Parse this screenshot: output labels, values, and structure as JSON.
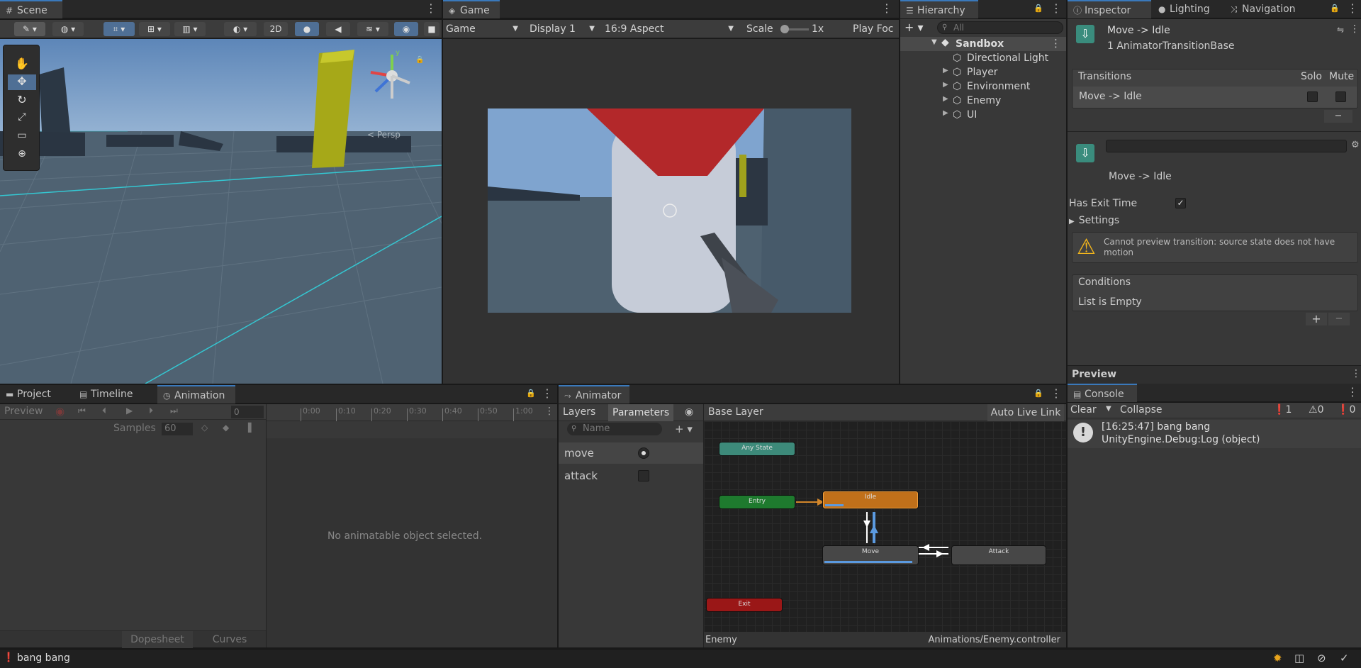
{
  "scene": {
    "tab": "Scene",
    "mode_2d": "2D",
    "persp_label": "< Persp",
    "axis_y": "y"
  },
  "game": {
    "tab": "Game",
    "display_mode": "Game",
    "display": "Display 1",
    "aspect": "16:9 Aspect",
    "scale_label": "Scale",
    "scale_value": "1x",
    "play_focused": "Play Foc"
  },
  "hierarchy": {
    "tab": "Hierarchy",
    "search_placeholder": "All",
    "scene_name": "Sandbox",
    "items": [
      {
        "label": "Directional Light",
        "expandable": false
      },
      {
        "label": "Player",
        "expandable": true
      },
      {
        "label": "Environment",
        "expandable": true
      },
      {
        "label": "Enemy",
        "expandable": true
      },
      {
        "label": "UI",
        "expandable": true
      }
    ]
  },
  "inspector": {
    "tabs": [
      "Inspector",
      "Lighting",
      "Navigation"
    ],
    "title": "Move -> Idle",
    "subtitle": "1 AnimatorTransitionBase",
    "transitions_header": "Transitions",
    "solo": "Solo",
    "mute": "Mute",
    "transition_row": "Move -> Idle",
    "transition_name": "Move -> Idle",
    "has_exit_time": "Has Exit Time",
    "settings": "Settings",
    "warning": "Cannot preview transition: source state does not have motion",
    "conditions": "Conditions",
    "conditions_empty": "List is Empty",
    "preview": "Preview"
  },
  "project_area": {
    "tabs": [
      "Project",
      "Timeline",
      "Animation"
    ],
    "preview": "Preview",
    "frame": "0",
    "samples_label": "Samples",
    "samples_value": "60",
    "timeline_ticks": [
      "0:00",
      "0:10",
      "0:20",
      "0:30",
      "0:40",
      "0:50",
      "1:00"
    ],
    "empty_message": "No animatable object selected.",
    "dopesheet": "Dopesheet",
    "curves": "Curves"
  },
  "animator": {
    "tab": "Animator",
    "layers": "Layers",
    "parameters": "Parameters",
    "search_placeholder": "Name",
    "params": [
      {
        "name": "move",
        "type": "trigger"
      },
      {
        "name": "attack",
        "type": "bool"
      }
    ],
    "base_layer": "Base Layer",
    "auto_live_link": "Auto Live Link",
    "nodes": {
      "any_state": "Any State",
      "entry": "Entry",
      "idle": "Idle",
      "move": "Move",
      "attack": "Attack",
      "exit": "Exit"
    },
    "footer_object": "Enemy",
    "footer_path": "Animations/Enemy.controller"
  },
  "console": {
    "tab": "Console",
    "clear": "Clear",
    "collapse": "Collapse",
    "count_log": "1",
    "count_warn": "0",
    "count_error": "0",
    "entry_line1": "[16:25:47] bang bang",
    "entry_line2": "UnityEngine.Debug:Log (object)"
  },
  "status_bar": {
    "message": "bang bang"
  },
  "colors": {
    "accent": "#3a79bb",
    "idle_node": "#c0701a",
    "entry_node": "#1e7a2e",
    "any_state_node": "#3d8a7a",
    "exit_node": "#9a1717",
    "grid_line": "#34c7d2"
  }
}
